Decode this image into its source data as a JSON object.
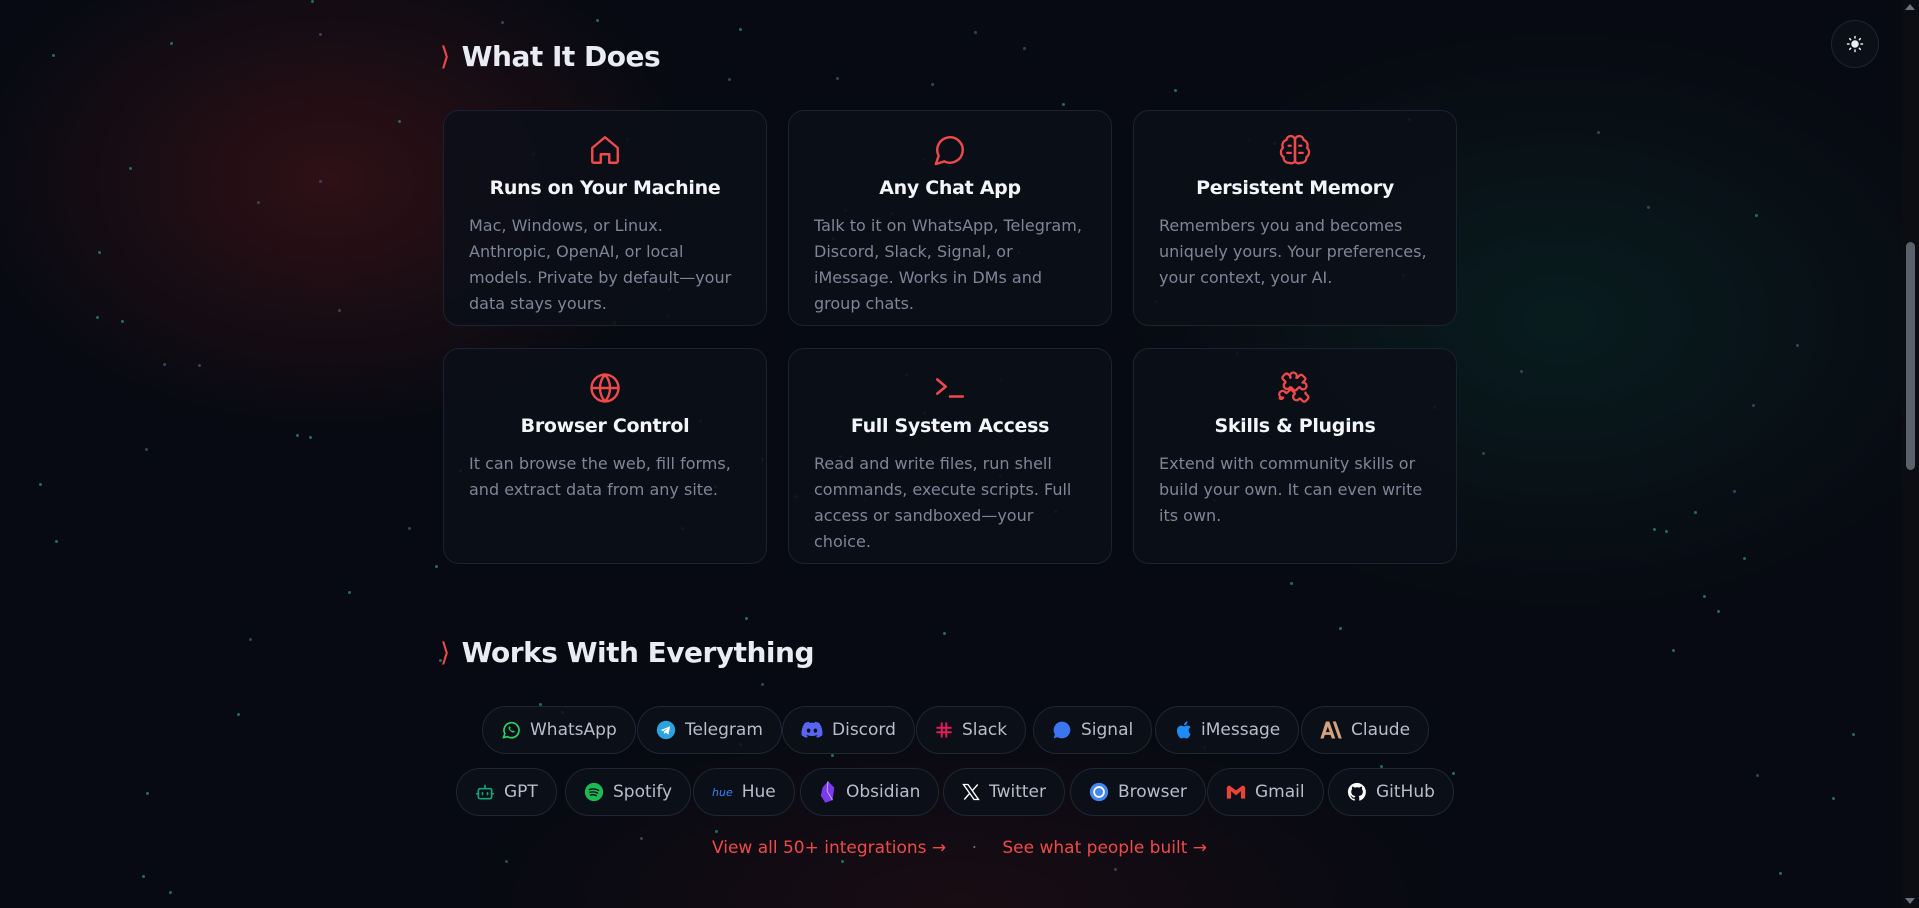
{
  "theme_toggle": {
    "icon": "sun-icon"
  },
  "what_it_does": {
    "title": "What It Does",
    "cards": [
      {
        "icon": "home-icon",
        "title": "Runs on Your Machine",
        "desc": "Mac, Windows, or Linux. Anthropic, OpenAI, or local models. Private by default—your data stays yours."
      },
      {
        "icon": "chat-bubble-icon",
        "title": "Any Chat App",
        "desc": "Talk to it on WhatsApp, Telegram, Discord, Slack, Signal, or iMessage. Works in DMs and group chats."
      },
      {
        "icon": "brain-icon",
        "title": "Persistent Memory",
        "desc": "Remembers you and becomes uniquely yours. Your preferences, your context, your AI."
      },
      {
        "icon": "globe-icon",
        "title": "Browser Control",
        "desc": "It can browse the web, fill forms, and extract data from any site."
      },
      {
        "icon": "terminal-icon",
        "title": "Full System Access",
        "desc": "Read and write files, run shell commands, execute scripts. Full access or sandboxed—your choice."
      },
      {
        "icon": "puzzle-icon",
        "title": "Skills & Plugins",
        "desc": "Extend with community skills or build your own. It can even write its own."
      }
    ]
  },
  "works_with": {
    "title": "Works With Everything",
    "integrations": [
      {
        "label": "WhatsApp",
        "icon": "whatsapp-icon",
        "color": "#25d366"
      },
      {
        "label": "Telegram",
        "icon": "telegram-icon",
        "color": "#2aa3e0"
      },
      {
        "label": "Discord",
        "icon": "discord-icon",
        "color": "#5865f2"
      },
      {
        "label": "Slack",
        "icon": "slack-icon",
        "color": "#e01e5a"
      },
      {
        "label": "Signal",
        "icon": "signal-icon",
        "color": "#3a76f0"
      },
      {
        "label": "iMessage",
        "icon": "apple-icon",
        "color": "#1d8cf8"
      },
      {
        "label": "Claude",
        "icon": "claude-icon",
        "color": "#d4a27f"
      },
      {
        "label": "GPT",
        "icon": "robot-icon",
        "color": "#10a37f"
      },
      {
        "label": "Spotify",
        "icon": "spotify-icon",
        "color": "#1db954"
      },
      {
        "label": "Hue",
        "icon": "hue-icon",
        "color": "#3b82f6",
        "icon_text": "hue"
      },
      {
        "label": "Obsidian",
        "icon": "obsidian-icon",
        "color": "#7c3aed"
      },
      {
        "label": "Twitter",
        "icon": "x-icon",
        "color": "#ffffff"
      },
      {
        "label": "Browser",
        "icon": "chrome-icon",
        "color": "#4285f4"
      },
      {
        "label": "Gmail",
        "icon": "gmail-icon",
        "color": "#ea4335"
      },
      {
        "label": "GitHub",
        "icon": "github-icon",
        "color": "#ffffff"
      }
    ]
  },
  "links": {
    "integrations": "View all 50+ integrations →",
    "separator": "·",
    "showcase": "See what people built →"
  },
  "colors": {
    "accent": "#ef4a4a",
    "background": "#070a12"
  }
}
